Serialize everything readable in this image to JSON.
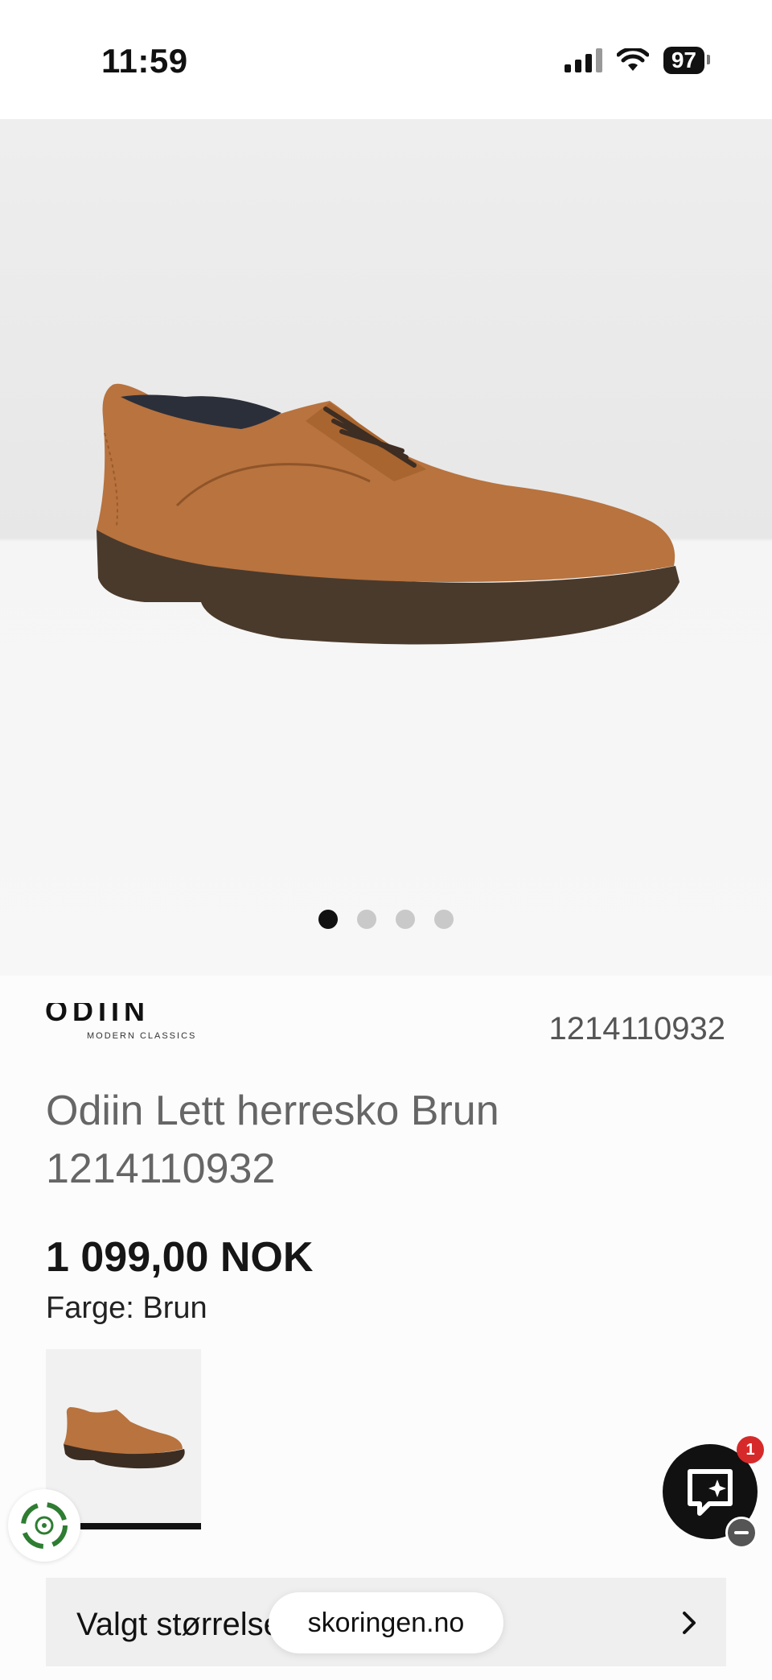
{
  "status_bar": {
    "time": "11:59",
    "battery": "97"
  },
  "gallery": {
    "dots": 4,
    "active_index": 0
  },
  "brand": {
    "name": "ODIIN",
    "tagline": "MODERN CLASSICS"
  },
  "product": {
    "sku": "1214110932",
    "title": "Odiin Lett herresko Brun 1214110932",
    "price": "1 099,00 NOK",
    "color_label": "Farge: Brun"
  },
  "size_selector": {
    "label": "Valgt størrelse"
  },
  "browser": {
    "url": "skoringen.no"
  },
  "chat": {
    "badge_count": "1"
  },
  "colors": {
    "shoe": "#b8733f",
    "sole": "#4a3a2c",
    "badge": "#d62a2a",
    "eco": "#2e7d32"
  }
}
